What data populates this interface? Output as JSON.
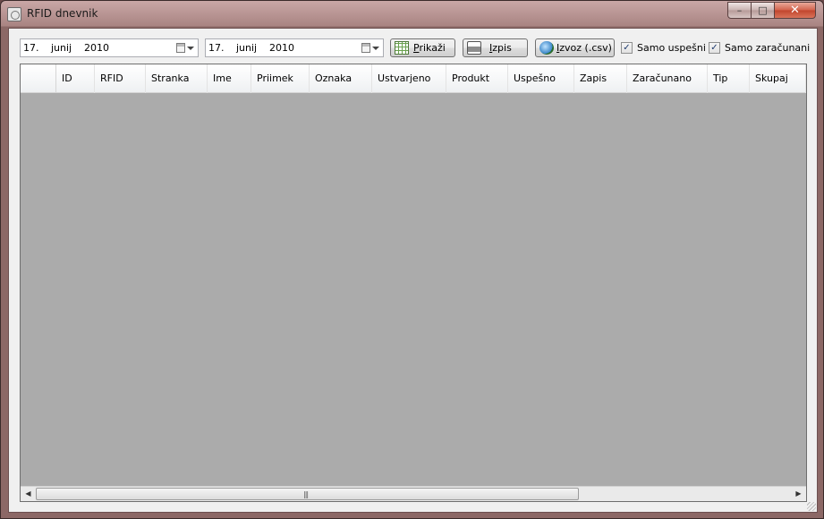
{
  "window": {
    "title": "RFID dnevnik",
    "controls": {
      "minimize": "–",
      "maximize": "□",
      "close": "✕"
    },
    "accent_color": "#b08886",
    "close_color": "#c94a32"
  },
  "toolbar": {
    "date_from": {
      "day": "17.",
      "month": "junij",
      "year": "2010"
    },
    "date_to": {
      "day": "17.",
      "month": "junij",
      "year": "2010"
    },
    "show_button": {
      "label": "Prikaži",
      "icon": "calendar-icon"
    },
    "print_button": {
      "label": "Izpis",
      "icon": "printer-icon"
    },
    "export_button": {
      "label": "Izvoz (.csv)",
      "icon": "export-globe-icon"
    },
    "only_successful": {
      "label": "Samo uspešni",
      "checked": true,
      "mark": "✓"
    },
    "only_billed": {
      "label": "Samo zaračunani",
      "checked": true,
      "mark": "✓"
    }
  },
  "grid": {
    "columns": [
      "ID",
      "RFID",
      "Stranka",
      "Ime",
      "Priimek",
      "Oznaka",
      "Ustvarjeno",
      "Produkt",
      "Uspešno",
      "Zapis",
      "Zaračunano",
      "Tip",
      "Skupaj"
    ],
    "rows": [],
    "background_color": "#ababab",
    "scrollbar": {
      "left_arrow": "◀",
      "right_arrow": "▶",
      "grip": "|||"
    }
  }
}
